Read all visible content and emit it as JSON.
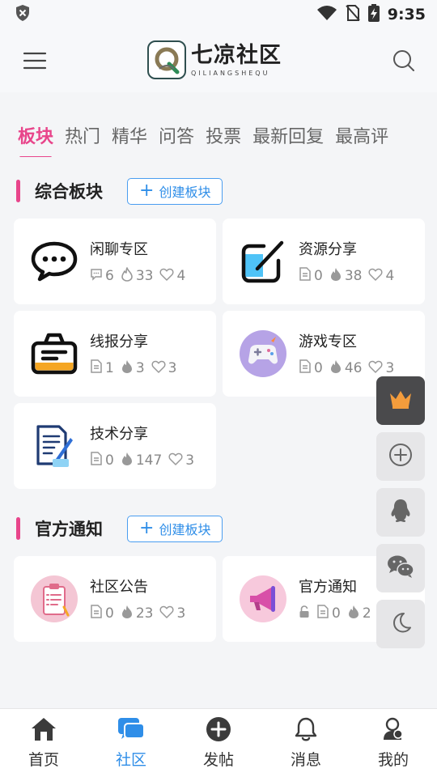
{
  "status_bar": {
    "time": "9:35"
  },
  "header": {
    "logo_title": "七凉社区",
    "logo_subtitle": "QILIANGSHEQU",
    "logo_letter": "Q"
  },
  "tabs": [
    {
      "label": "板块",
      "active": true
    },
    {
      "label": "热门"
    },
    {
      "label": "精华"
    },
    {
      "label": "问答"
    },
    {
      "label": "投票"
    },
    {
      "label": "最新回复"
    },
    {
      "label": "最高评"
    }
  ],
  "sections": [
    {
      "title": "综合板块",
      "create_label": "创建板块",
      "boards": [
        {
          "name": "闲聊专区",
          "posts": "6",
          "hot": "33",
          "likes": "4",
          "icon": "chat-bubble-icon",
          "post_icon": "message-icon"
        },
        {
          "name": "资源分享",
          "posts": "0",
          "hot": "38",
          "likes": "4",
          "icon": "share-edit-icon",
          "post_icon": "document-icon"
        },
        {
          "name": "线报分享",
          "posts": "1",
          "hot": "3",
          "likes": "3",
          "icon": "toolbox-icon",
          "post_icon": "document-icon"
        },
        {
          "name": "游戏专区",
          "posts": "0",
          "hot": "46",
          "likes": "3",
          "icon": "gamepad-icon",
          "post_icon": "document-icon"
        },
        {
          "name": "技术分享",
          "posts": "0",
          "hot": "147",
          "likes": "3",
          "icon": "notepad-pen-icon",
          "post_icon": "document-icon"
        }
      ]
    },
    {
      "title": "官方通知",
      "create_label": "创建板块",
      "boards": [
        {
          "name": "社区公告",
          "posts": "0",
          "hot": "23",
          "likes": "3",
          "icon": "clipboard-icon",
          "post_icon": "document-icon"
        },
        {
          "name": "官方通知",
          "posts": "0",
          "hot": "2",
          "likes": "",
          "icon": "megaphone-icon",
          "post_icon": "document-icon",
          "locked": true
        }
      ]
    }
  ],
  "float_buttons": [
    "crown-icon",
    "add-circle-icon",
    "qq-icon",
    "wechat-icon",
    "moon-icon"
  ],
  "bottom_nav": [
    {
      "label": "首页",
      "icon": "home-icon"
    },
    {
      "label": "社区",
      "icon": "community-icon",
      "active": true
    },
    {
      "label": "发帖",
      "icon": "post-add-icon"
    },
    {
      "label": "消息",
      "icon": "bell-icon"
    },
    {
      "label": "我的",
      "icon": "profile-icon"
    }
  ],
  "colors": {
    "accent": "#e8458b",
    "link": "#2f8ee8",
    "page_bg": "#f4f5f7"
  }
}
